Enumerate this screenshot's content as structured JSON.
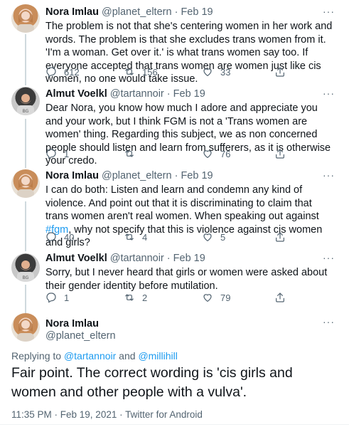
{
  "colors": {
    "accent": "#1d9bf0",
    "text": "#0f1419",
    "muted": "#536471",
    "thread_line": "#cfd9de"
  },
  "tweets": [
    {
      "name": "Nora Imlau",
      "handle": "@planet_eltern",
      "dot": "·",
      "time": "Feb 19",
      "more": "···",
      "avatar": "nora-avatar",
      "text": "The problem is not that she's centering women in her work and words. The problem is that she excludes trans women from it. 'I'm a woman. Get over it.' is what trans women say too. If everyone accepted that trans women are women just like cis women, no one would take issue.",
      "replies": "612",
      "retweets": "156",
      "likes": "33"
    },
    {
      "name": "Almut Voelkl",
      "handle": "@tartannoir",
      "dot": "·",
      "time": "Feb 19",
      "more": "···",
      "avatar": "almut-avatar",
      "text": "Dear Nora, you know how much I adore and appreciate you and your work, but I think FGM is not a 'Trans women are women' thing. Regarding this subject, we as non concerned people should listen and learn from sufferers, as it is otherwise your credo.",
      "replies": "1",
      "retweets": "",
      "likes": "76"
    },
    {
      "name": "Nora Imlau",
      "handle": "@planet_eltern",
      "dot": "·",
      "time": "Feb 19",
      "more": "···",
      "avatar": "nora-avatar",
      "text_before": "I can do both: Listen and learn and condemn any kind of violence. And point out that it is discriminating to claim that trans women aren't real women. When speaking out against ",
      "hashtag": "#fgm",
      "text_after": ", why not specify that this is violence against cis women and girls?",
      "replies": "40",
      "retweets": "4",
      "likes": "5"
    },
    {
      "name": "Almut Voelkl",
      "handle": "@tartannoir",
      "dot": "·",
      "time": "Feb 19",
      "more": "···",
      "avatar": "almut-avatar",
      "text": "Sorry, but I never heard that girls or women were asked about their gender identity before mutilation.",
      "replies": "1",
      "retweets": "2",
      "likes": "79"
    }
  ],
  "main_tweet": {
    "name": "Nora Imlau",
    "handle": "@planet_eltern",
    "more": "···",
    "replying_prefix": "Replying to ",
    "replying_user1": "@tartannoir",
    "replying_and": " and ",
    "replying_user2": "@millihill",
    "text": "Fair point. The correct wording is 'cis girls and women and other people with a vulva'.",
    "timestamp": "11:35 PM · Feb 19, 2021 · Twitter for Android"
  }
}
